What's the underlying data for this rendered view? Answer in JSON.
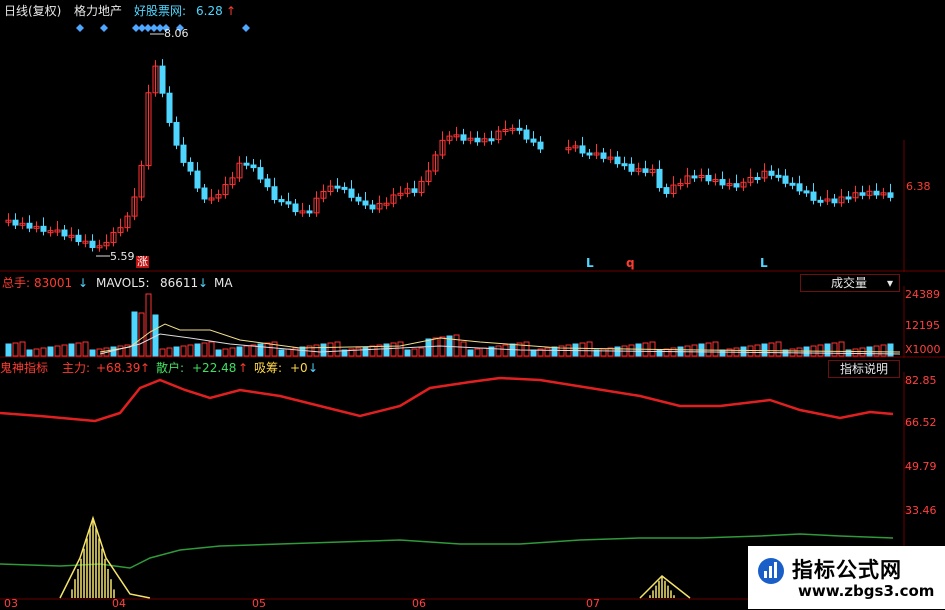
{
  "header": {
    "period": "日线(复权)",
    "stock_name": "格力地产",
    "site": "好股票网:",
    "price": "6.28",
    "up_arrow": "↑"
  },
  "price_chart": {
    "high_label": "8.06",
    "low_label": "5.59",
    "zhang_label": "涨",
    "axis_price": "6.38",
    "markers": [
      "L",
      "q",
      "L"
    ]
  },
  "volume_pane": {
    "total_label": "总手:",
    "total_value": "83001",
    "total_arrow": "↓",
    "mavol_label": "MAVOL5:",
    "mavol_value": "86611",
    "mavol_arrow": "↓",
    "ma_label": "MA",
    "button": "成交量",
    "dropdown_arrow": "▾",
    "axis": [
      "24389",
      "12195",
      "X1000"
    ]
  },
  "indicator_pane": {
    "name": "鬼神指标",
    "zhuli_label": "主力:",
    "zhuli_value": "+68.39",
    "zhuli_arrow": "↑",
    "sanhu_label": "散户:",
    "sanhu_value": "+22.48",
    "sanhu_arrow": "↑",
    "xichou_label": "吸筹:",
    "xichou_value": "+0",
    "xichou_arrow": "↓",
    "button": "指标说明",
    "axis": [
      "82.85",
      "66.52",
      "49.79",
      "33.46"
    ]
  },
  "dates": [
    "03",
    "04",
    "05",
    "06",
    "07"
  ],
  "watermark": {
    "title": "指标公式网",
    "url": "www.zbgs3.com"
  },
  "colors": {
    "up": "#ff3333",
    "down": "#4fd6ff",
    "zhuli": "#e02020",
    "sanhu": "#2f9a3a",
    "xichou": "#f5e26a",
    "grid": "#6a0000"
  }
}
